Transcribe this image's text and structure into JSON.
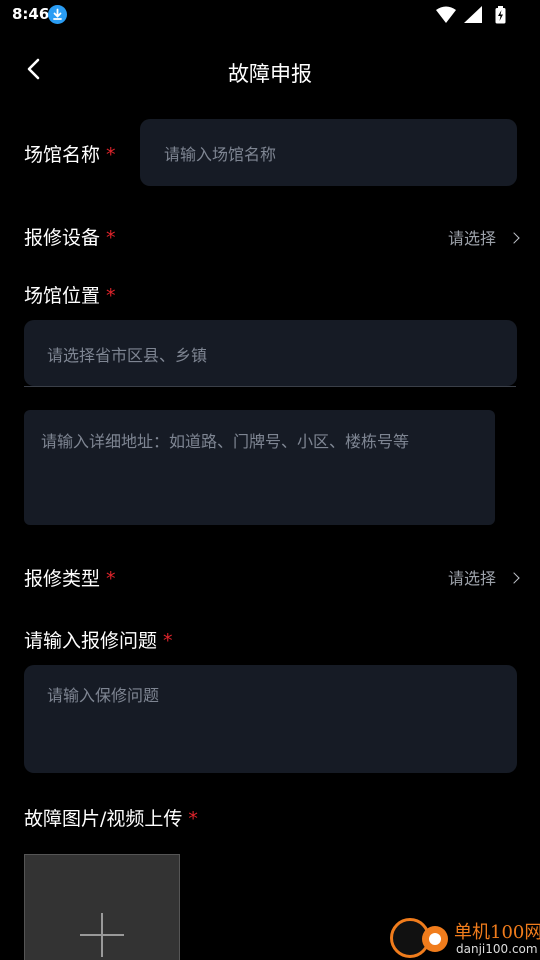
{
  "status_bar": {
    "time": "8:46",
    "icons": [
      "download-icon",
      "wifi-icon",
      "signal-icon",
      "battery-icon"
    ]
  },
  "header": {
    "title": "故障申报",
    "back_icon": "chevron-left-icon"
  },
  "form": {
    "venue_name": {
      "label": "场馆名称",
      "required_mark": "*",
      "placeholder": "请输入场馆名称"
    },
    "equipment": {
      "label": "报修设备",
      "required_mark": "*",
      "select_text": "请选择"
    },
    "location": {
      "label": "场馆位置",
      "required_mark": "*",
      "region_placeholder": "请选择省市区县、乡镇",
      "address_placeholder": "请输入详细地址：如道路、门牌号、小区、楼栋号等"
    },
    "repair_type": {
      "label": "报修类型",
      "required_mark": "*",
      "select_text": "请选择"
    },
    "problem": {
      "label": "请输入报修问题",
      "required_mark": "*",
      "placeholder": "请输入保修问题"
    },
    "upload": {
      "label": "故障图片/视频上传",
      "required_mark": "*",
      "icon": "plus-icon"
    }
  },
  "watermark": {
    "name": "单机100网",
    "url": "danji100.com"
  },
  "colors": {
    "background": "#000000",
    "field_bg": "#161b25",
    "required": "#e0242b",
    "placeholder": "#7e8592",
    "watermark_accent": "#f07c1c"
  }
}
